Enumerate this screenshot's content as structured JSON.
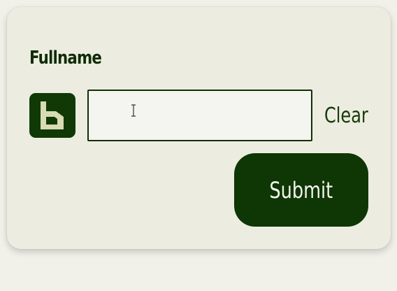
{
  "form": {
    "field_label": "Fullname",
    "input_value": "",
    "input_placeholder": "",
    "clear_label": "Clear",
    "submit_label": "Submit",
    "logo_icon": "b-logo-icon",
    "cursor_icon": "text-cursor-icon"
  },
  "colors": {
    "accent": "#0f3605",
    "card_background": "#ecede0",
    "page_background": "#f1f1ea",
    "logo_glyph": "#d8dbb4"
  }
}
